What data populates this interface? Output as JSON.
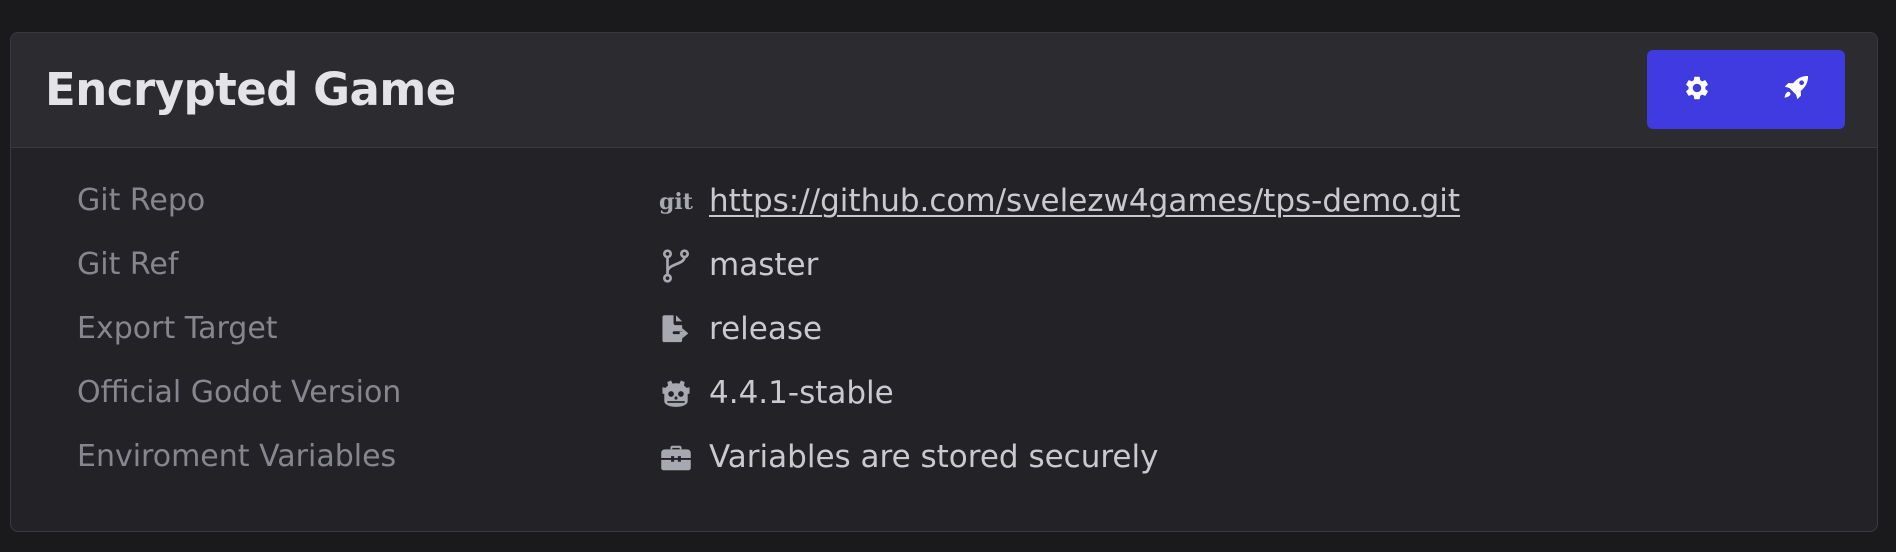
{
  "card": {
    "title": "Encrypted Game",
    "actions": {
      "settings_icon": "gear-icon",
      "deploy_icon": "rocket-icon",
      "accent_color": "#3f3be0"
    }
  },
  "details": [
    {
      "label": "Git Repo",
      "icon": "git-icon",
      "icon_text": "git",
      "value": "https://github.com/svelezw4games/tps-demo.git",
      "is_link": true
    },
    {
      "label": "Git Ref",
      "icon": "branch-icon",
      "value": "master"
    },
    {
      "label": "Export Target",
      "icon": "file-export-icon",
      "value": "release"
    },
    {
      "label": "Official Godot Version",
      "icon": "godot-icon",
      "value": "4.4.1-stable"
    },
    {
      "label": "Enviroment Variables",
      "icon": "toolbox-icon",
      "value": "Variables are stored securely"
    }
  ]
}
